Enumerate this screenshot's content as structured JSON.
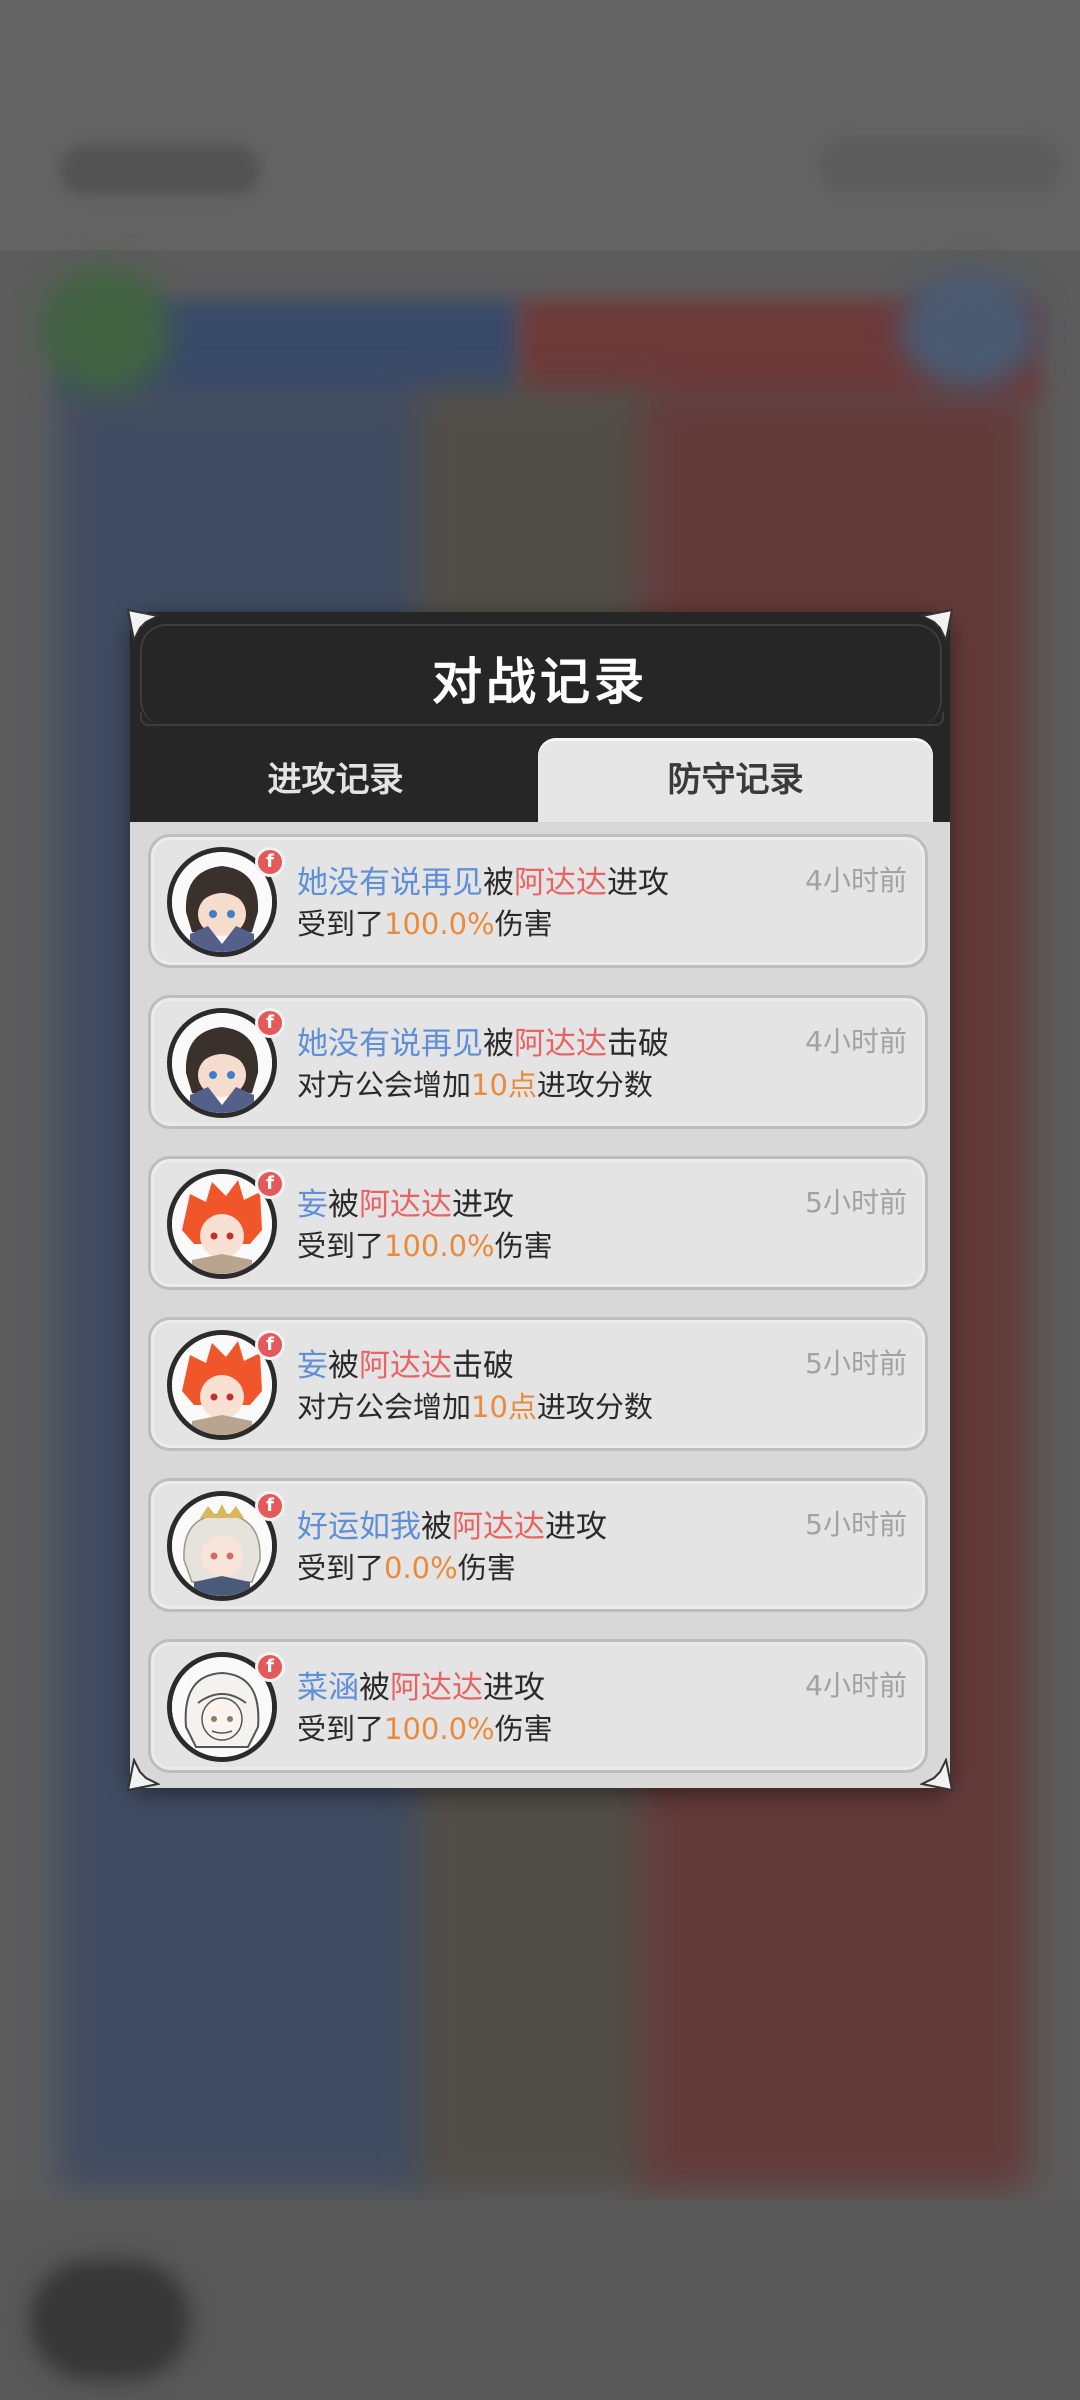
{
  "dialog": {
    "title": "对战记录",
    "tabs": [
      {
        "label": "进攻记录",
        "selected": false
      },
      {
        "label": "防守记录",
        "selected": true
      }
    ]
  },
  "records": [
    {
      "player": "她没有说再见",
      "by": "被",
      "attacker": "阿达达",
      "action": "进攻",
      "detail_prefix": "受到了",
      "detail_value": "100.0%",
      "detail_suffix": "伤害",
      "time": "4小时前",
      "badge": "f",
      "avatar": "dark-hair-girl-avatar"
    },
    {
      "player": "她没有说再见",
      "by": "被",
      "attacker": "阿达达",
      "action": "击破",
      "detail_prefix": "对方公会增加",
      "detail_value": "10点",
      "detail_suffix": "进攻分数",
      "time": "4小时前",
      "badge": "f",
      "avatar": "dark-hair-girl-avatar"
    },
    {
      "player": "妄",
      "by": "被",
      "attacker": "阿达达",
      "action": "进攻",
      "detail_prefix": "受到了",
      "detail_value": "100.0%",
      "detail_suffix": "伤害",
      "time": "5小时前",
      "badge": "f",
      "avatar": "red-hair-boy-avatar"
    },
    {
      "player": "妄",
      "by": "被",
      "attacker": "阿达达",
      "action": "击破",
      "detail_prefix": "对方公会增加",
      "detail_value": "10点",
      "detail_suffix": "进攻分数",
      "time": "5小时前",
      "badge": "f",
      "avatar": "red-hair-boy-avatar"
    },
    {
      "player": "好运如我",
      "by": "被",
      "attacker": "阿达达",
      "action": "进攻",
      "detail_prefix": "受到了",
      "detail_value": "0.0%",
      "detail_suffix": "伤害",
      "time": "5小时前",
      "badge": "f",
      "avatar": "white-hair-crown-girl-avatar"
    },
    {
      "player": "菜涵",
      "by": "被",
      "attacker": "阿达达",
      "action": "进攻",
      "detail_prefix": "受到了",
      "detail_value": "100.0%",
      "detail_suffix": "伤害",
      "time": "4小时前",
      "badge": "f",
      "avatar": "white-hair-sketch-avatar"
    }
  ],
  "colors": {
    "player_name": "#5f8fd6",
    "attacker_name": "#e86464",
    "value": "#ea8a3c",
    "badge": "#e45a5a"
  }
}
